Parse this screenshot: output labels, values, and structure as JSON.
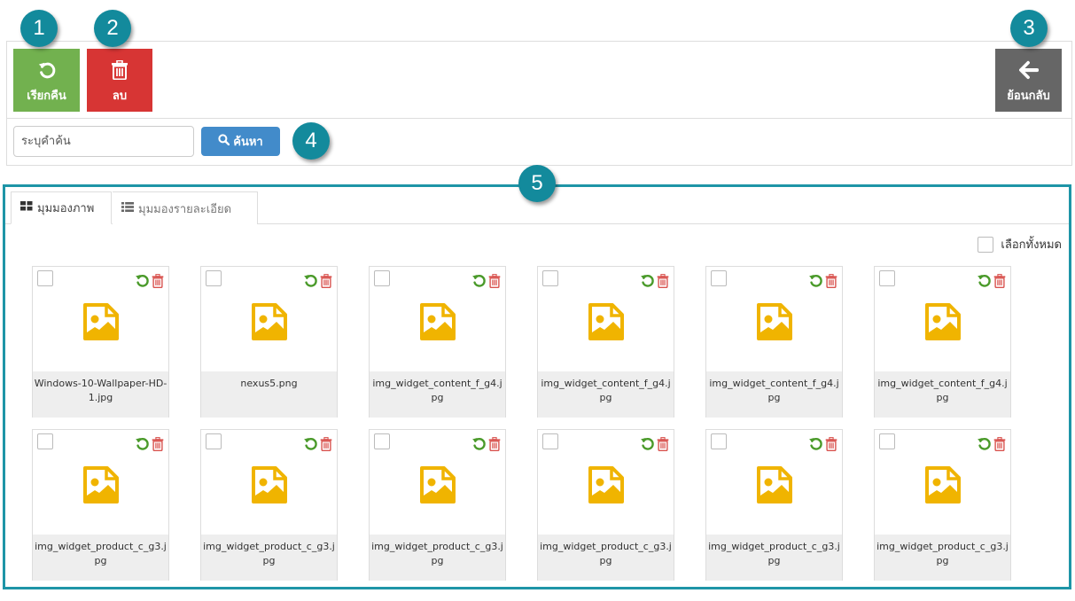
{
  "toolbar": {
    "restore_label": "เรียกคืน",
    "delete_label": "ลบ",
    "back_label": "ย้อนกลับ",
    "colors": {
      "restore": "#72b14f",
      "delete": "#d73534",
      "back": "#666666"
    }
  },
  "search": {
    "placeholder": "ระบุคำค้น",
    "value": "",
    "button_label": "ค้นหา"
  },
  "badges": [
    "1",
    "2",
    "3",
    "4",
    "5"
  ],
  "gallery": {
    "tabs": [
      {
        "label": "มุมมองภาพ",
        "icon": "grid-icon",
        "active": true
      },
      {
        "label": "มุมมองรายละเอียด",
        "icon": "list-icon",
        "active": false
      }
    ],
    "select_all_label": "เลือกทั้งหมด",
    "files": [
      {
        "name": "Windows-10-Wallpaper-HD-1.jpg"
      },
      {
        "name": "nexus5.png"
      },
      {
        "name": "img_widget_content_f_g4.jpg"
      },
      {
        "name": "img_widget_content_f_g4.jpg"
      },
      {
        "name": "img_widget_content_f_g4.jpg"
      },
      {
        "name": "img_widget_content_f_g4.jpg"
      },
      {
        "name": "img_widget_product_c_g3.jpg"
      },
      {
        "name": "img_widget_product_c_g3.jpg"
      },
      {
        "name": "img_widget_product_c_g3.jpg"
      },
      {
        "name": "img_widget_product_c_g3.jpg"
      },
      {
        "name": "img_widget_product_c_g3.jpg"
      },
      {
        "name": "img_widget_product_c_g3.jpg"
      }
    ]
  },
  "accent_color": "#1e95a7",
  "icon_colors": {
    "restore": "#4a9a2a",
    "delete": "#d9534f",
    "file": "#f0b400"
  }
}
